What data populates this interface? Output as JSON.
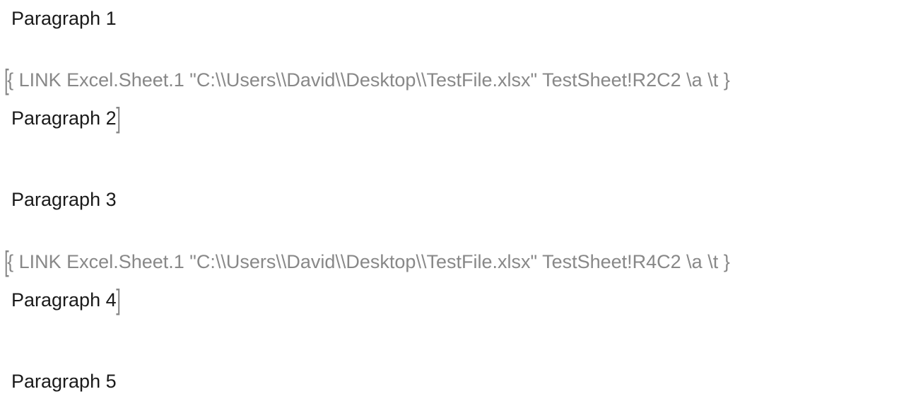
{
  "paragraphs": {
    "p1": "Paragraph 1",
    "p2": "Paragraph 2",
    "p3": "Paragraph 3",
    "p4": "Paragraph 4",
    "p5": "Paragraph 5"
  },
  "fields": {
    "f1": "{ LINK Excel.Sheet.1 \"C:\\\\Users\\\\David\\\\Desktop\\\\TestFile.xlsx\" TestSheet!R2C2 \\a \\t }",
    "f2": "{ LINK Excel.Sheet.1 \"C:\\\\Users\\\\David\\\\Desktop\\\\TestFile.xlsx\" TestSheet!R4C2 \\a \\t }"
  }
}
